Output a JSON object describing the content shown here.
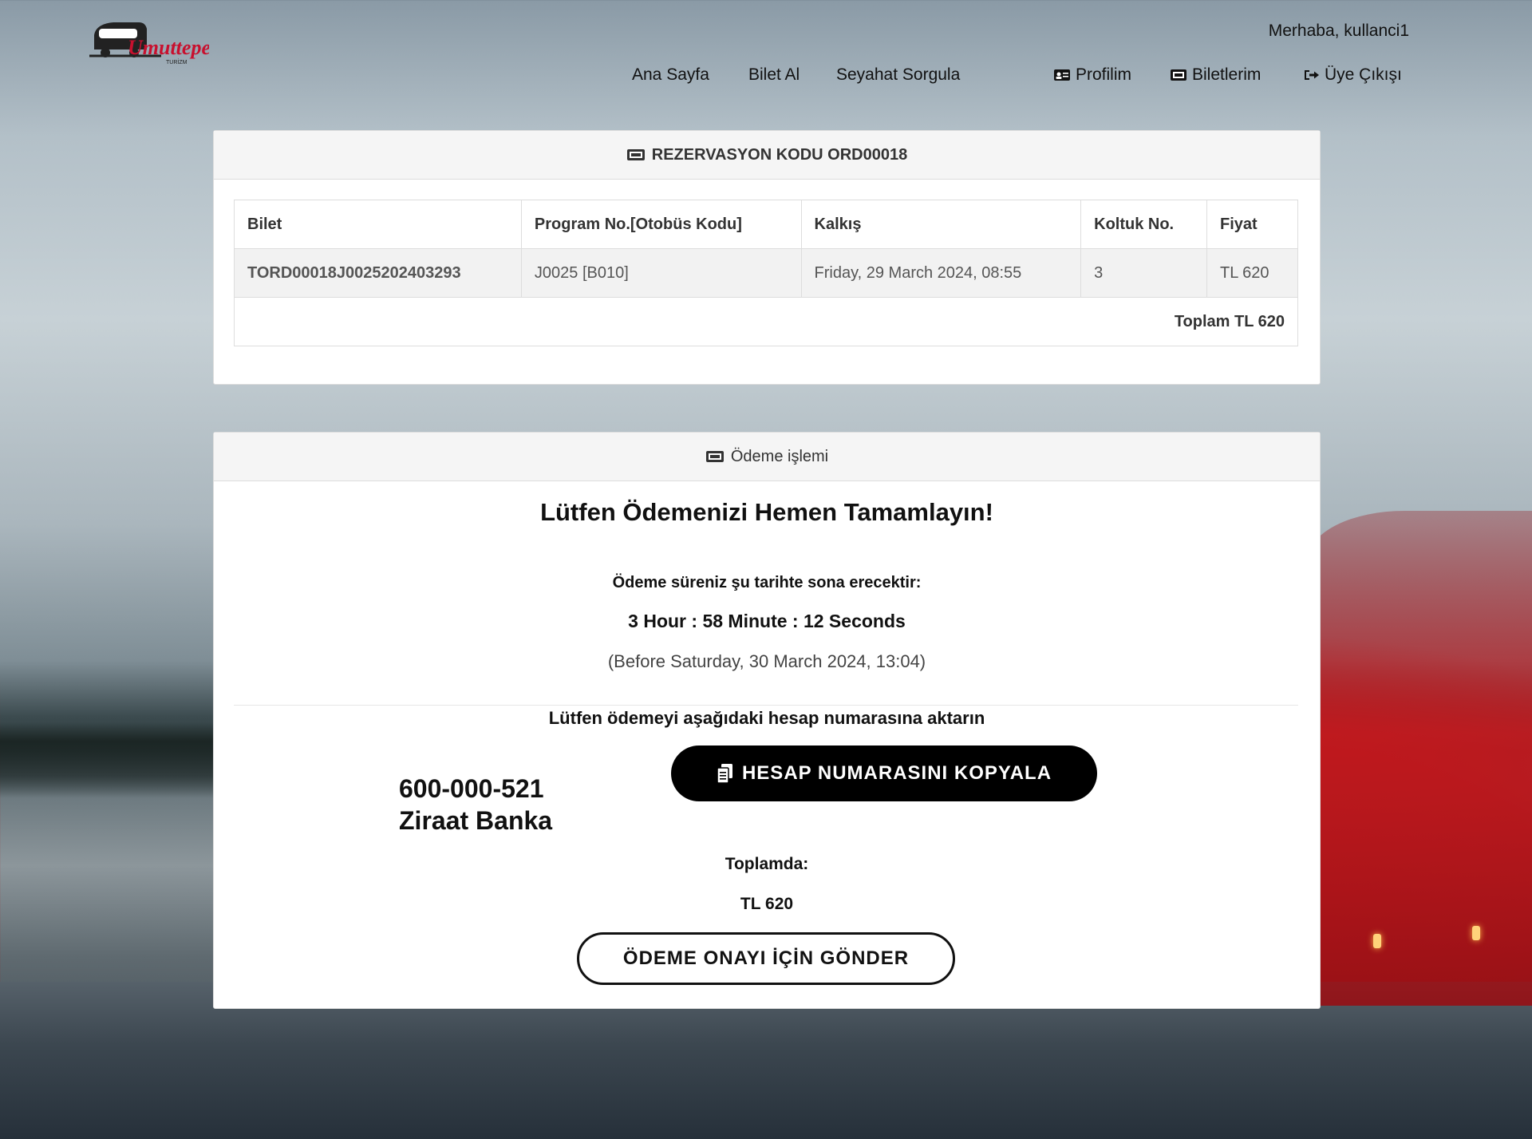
{
  "header": {
    "greeting": "Merhaba, kullanci1",
    "nav": {
      "home": "Ana Sayfa",
      "buy_ticket": "Bilet Al",
      "trip_query": "Seyahat Sorgula",
      "profile": "Profilim",
      "my_tickets": "Biletlerim",
      "logout": "Üye Çıkışı"
    },
    "logo": {
      "text": "Umuttepe",
      "subtext": "TURİZM",
      "color": "#c8102e"
    }
  },
  "reservation": {
    "title": "REZERVASYON KODU ORD00018",
    "columns": [
      "Bilet",
      "Program No.[Otobüs Kodu]",
      "Kalkış",
      "Koltuk No.",
      "Fiyat"
    ],
    "rows": [
      {
        "ticket": "TORD00018J0025202403293",
        "program": "J0025 [B010]",
        "departure": "Friday, 29 March 2024, 08:55",
        "seat": "3",
        "price": "TL 620"
      }
    ],
    "total": "Toplam TL 620"
  },
  "payment": {
    "header": "Ödeme işlemi",
    "title": "Lütfen Ödemenizi Hemen Tamamlayın!",
    "deadline_label": "Ödeme süreniz şu tarihte sona erecektir:",
    "countdown": "3 Hour : 58 Minute : 12 Seconds",
    "deadline": "(Before Saturday, 30 March 2024, 13:04)",
    "transfer_label": "Lütfen ödemeyi aşağıdaki hesap numarasına aktarın",
    "account_number": "600-000-521",
    "bank": "Ziraat Banka",
    "copy_button": "HESAP NUMARASINI KOPYALA",
    "total_label": "Toplamda:",
    "total_amount": "TL 620",
    "confirm_button": "ÖDEME ONAYI İÇİN GÖNDER"
  }
}
